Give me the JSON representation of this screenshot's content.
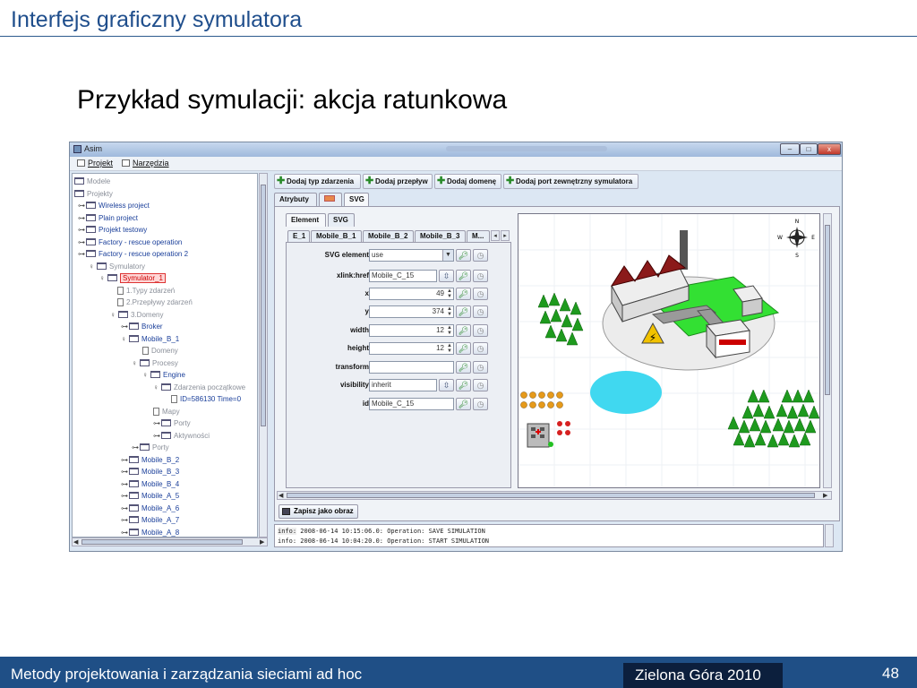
{
  "slide": {
    "title": "Interfejs graficzny symulatora",
    "subtitle": "Przykład symulacji: akcja ratunkowa",
    "footer_left": "Metody projektowania i zarządzania sieciami ad hoc",
    "footer_mid": "Zielona Góra 2010",
    "page_number": "48"
  },
  "window": {
    "title": "Asim",
    "controls": [
      "–",
      "□",
      "x"
    ]
  },
  "menu": [
    "Projekt",
    "Narzędzia"
  ],
  "tree": [
    {
      "label": "Modele",
      "kind": "folder",
      "gray": true,
      "tog": ""
    },
    {
      "label": "Projekty",
      "kind": "folder",
      "gray": true,
      "tog": ""
    },
    {
      "label": "Wireless project",
      "kind": "folder",
      "gray": false,
      "tog": "⊶"
    },
    {
      "label": "Plain project",
      "kind": "folder",
      "gray": false,
      "tog": "⊶"
    },
    {
      "label": "Projekt testowy",
      "kind": "folder",
      "gray": false,
      "tog": "⊶"
    },
    {
      "label": "Factory - rescue operation",
      "kind": "folder",
      "gray": false,
      "tog": "⊶"
    },
    {
      "label": "Factory - rescue operation 2",
      "kind": "folder",
      "gray": false,
      "tog": "⊶"
    },
    {
      "label": "Symulatory",
      "kind": "folder",
      "gray": true,
      "tog": "♀"
    },
    {
      "label": "Symulator_1",
      "kind": "folder",
      "gray": false,
      "tog": "♀",
      "selected": true
    },
    {
      "label": "1.Typy zdarzeń",
      "kind": "doc",
      "gray": true,
      "tog": ""
    },
    {
      "label": "2.Przepływy zdarzeń",
      "kind": "doc",
      "gray": true,
      "tog": ""
    },
    {
      "label": "3.Domeny",
      "kind": "folder",
      "gray": true,
      "tog": "♀"
    },
    {
      "label": "Broker",
      "kind": "folder",
      "gray": false,
      "tog": "⊶"
    },
    {
      "label": "Mobile_B_1",
      "kind": "folder",
      "gray": false,
      "tog": "♀"
    },
    {
      "label": "Domeny",
      "kind": "doc",
      "gray": true,
      "tog": ""
    },
    {
      "label": "Procesy",
      "kind": "folder",
      "gray": true,
      "tog": "♀"
    },
    {
      "label": "Engine",
      "kind": "folder",
      "gray": false,
      "tog": "♀"
    },
    {
      "label": "Zdarzenia początkowe",
      "kind": "folder",
      "gray": true,
      "tog": "♀"
    },
    {
      "label": "ID=586130 Time=0",
      "kind": "doc",
      "gray": false,
      "tog": ""
    },
    {
      "label": "Mapy",
      "kind": "doc",
      "gray": true,
      "tog": ""
    },
    {
      "label": "Porty",
      "kind": "folder",
      "gray": true,
      "tog": "⊶"
    },
    {
      "label": "Aktywności",
      "kind": "folder",
      "gray": true,
      "tog": "⊶"
    },
    {
      "label": "Porty",
      "kind": "folder",
      "gray": true,
      "tog": "⊶"
    },
    {
      "label": "Mobile_B_2",
      "kind": "folder",
      "gray": false,
      "tog": "⊶"
    },
    {
      "label": "Mobile_B_3",
      "kind": "folder",
      "gray": false,
      "tog": "⊶"
    },
    {
      "label": "Mobile_B_4",
      "kind": "folder",
      "gray": false,
      "tog": "⊶"
    },
    {
      "label": "Mobile_A_5",
      "kind": "folder",
      "gray": false,
      "tog": "⊶"
    },
    {
      "label": "Mobile_A_6",
      "kind": "folder",
      "gray": false,
      "tog": "⊶"
    },
    {
      "label": "Mobile_A_7",
      "kind": "folder",
      "gray": false,
      "tog": "⊶"
    },
    {
      "label": "Mobile_A_8",
      "kind": "folder",
      "gray": false,
      "tog": "⊶"
    }
  ],
  "toolbar": {
    "add_event_type": "Dodaj typ zdarzenia",
    "add_flow": "Dodaj przepływ",
    "add_domain": "Dodaj domenę",
    "add_port": "Dodaj port zewnętrzny symulatora"
  },
  "tabs_main": [
    "Atrybuty",
    "SVG"
  ],
  "tabs_sub": [
    "Element",
    "SVG"
  ],
  "tabs_elements": [
    "E_1",
    "Mobile_B_1",
    "Mobile_B_2",
    "Mobile_B_3",
    "M..."
  ],
  "form": {
    "svg_element": {
      "label": "SVG element",
      "value": "use"
    },
    "xlink_href": {
      "label": "xlink:href",
      "value": "Mobile_C_15"
    },
    "x": {
      "label": "x",
      "value": "49"
    },
    "y": {
      "label": "y",
      "value": "374"
    },
    "width": {
      "label": "width",
      "value": "12"
    },
    "height": {
      "label": "height",
      "value": "12"
    },
    "transform": {
      "label": "transform",
      "value": ""
    },
    "visibility": {
      "label": "visibility",
      "value": "inherit"
    },
    "id": {
      "label": "id",
      "value": "Mobile_C_15"
    }
  },
  "compass": {
    "n": "N",
    "s": "S",
    "e": "E",
    "w": "W"
  },
  "save_button": "Zapisz jako obraz",
  "log": [
    {
      "tag": "info:",
      "text": " 2008-06-14 10:15:06.0: Operation: SAVE SIMULATION"
    },
    {
      "tag": "info:",
      "text": " 2008-06-14 10:04:20.0: Operation: START SIMULATION"
    }
  ],
  "colors": {
    "title_blue": "#1f4e8c",
    "footer_blue": "#1f4f86",
    "footer_dark": "#0c1f3d",
    "tree_blue": "#1a3f9a",
    "grass_green": "#33e033",
    "water": "#40d8f0"
  }
}
